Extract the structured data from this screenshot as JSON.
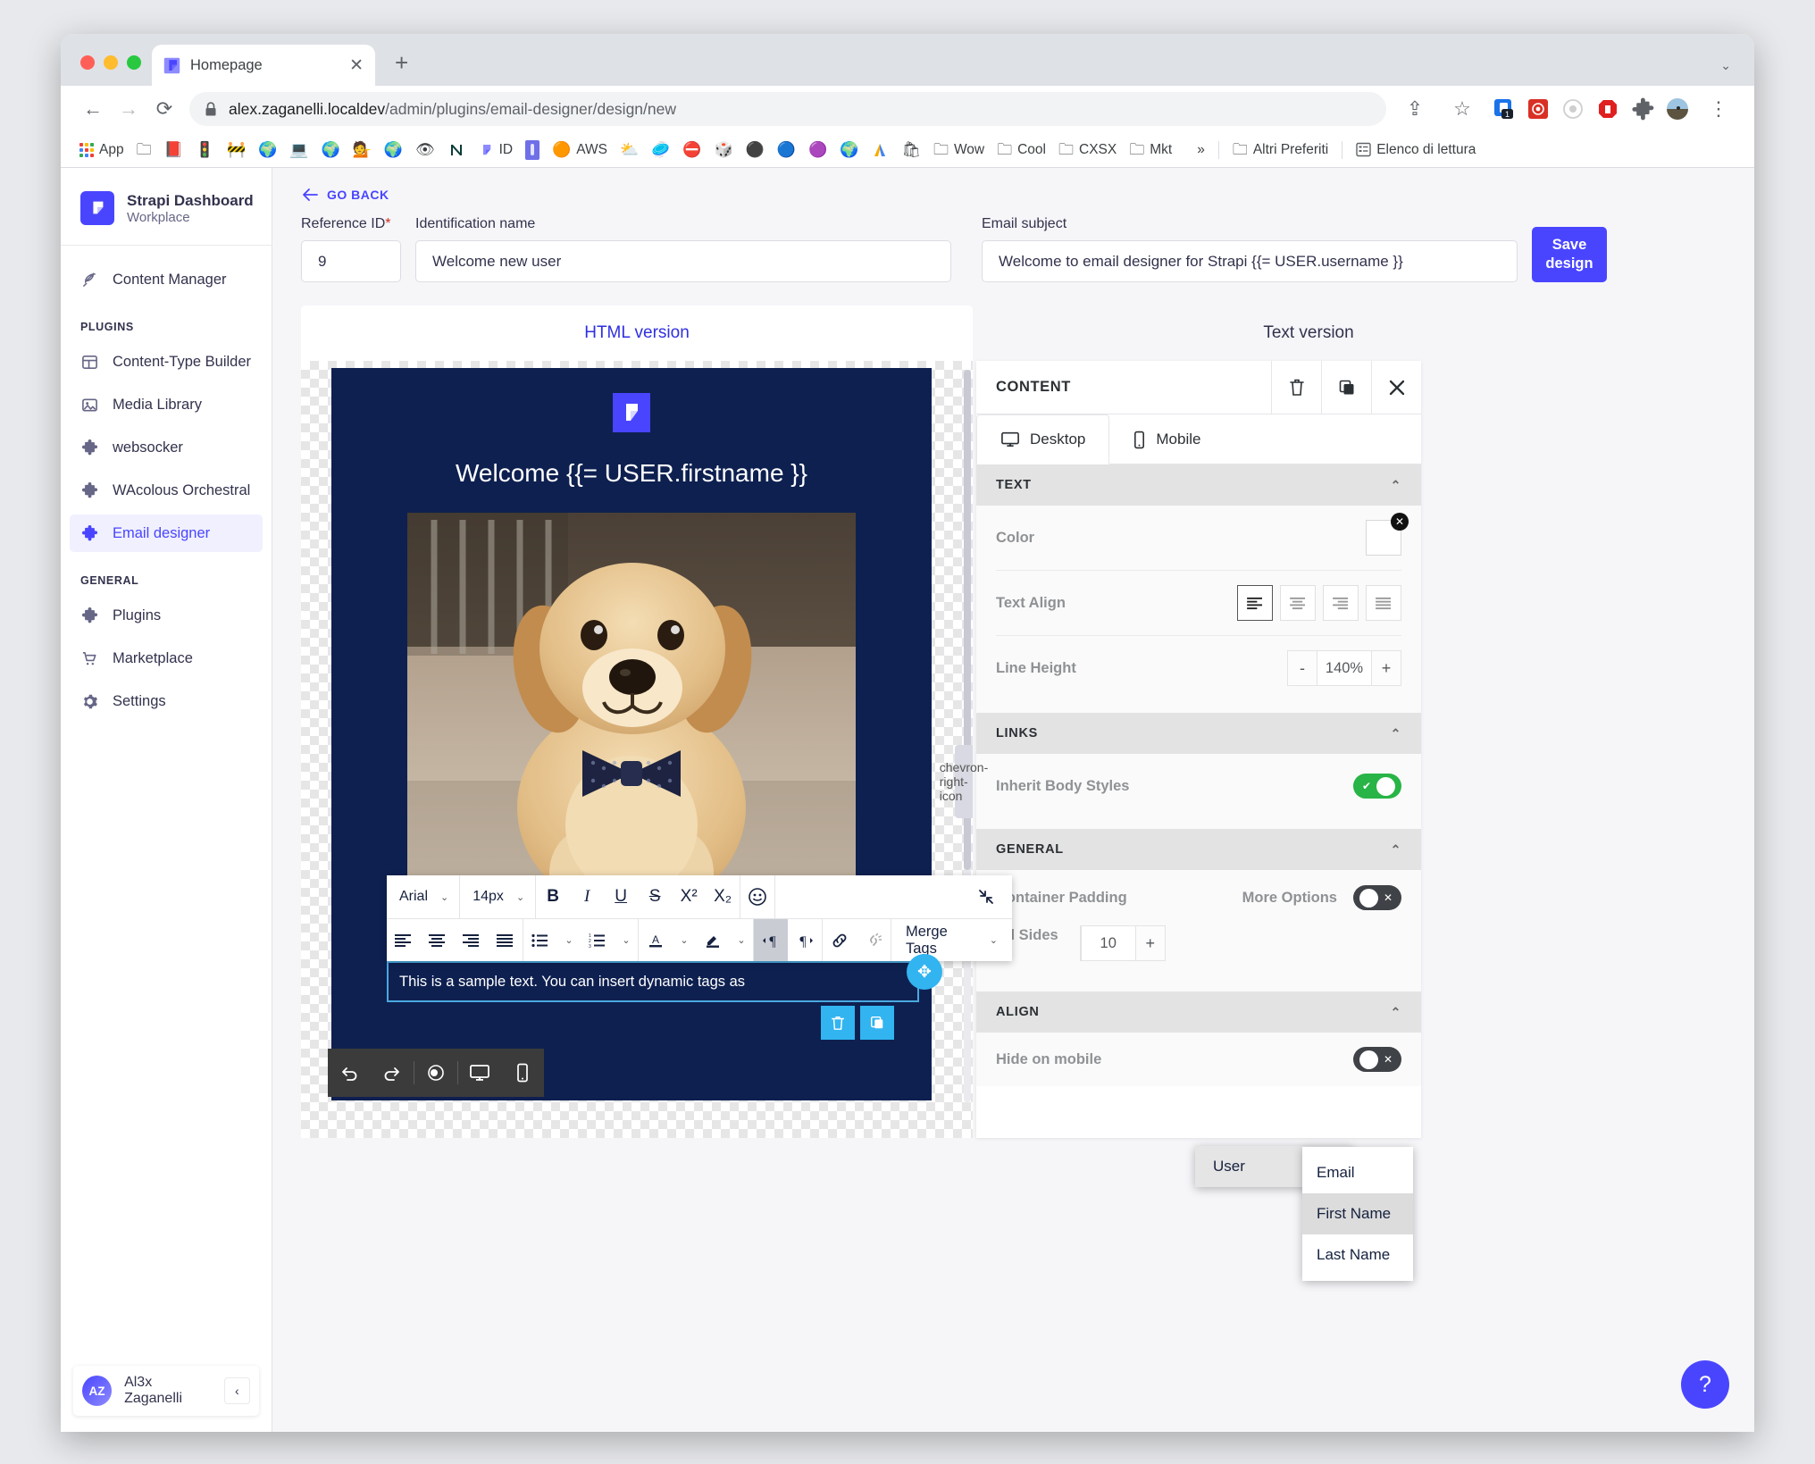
{
  "browser": {
    "tab_title": "Homepage",
    "tab_favicon": "strapi-logo-icon",
    "new_tab": "+",
    "url_host": "alex.zaganelli.localdev",
    "url_path": "/admin/plugins/email-designer/design/new",
    "back_icon": "←",
    "forward_icon": "→",
    "reload_icon": "⟳",
    "lock_icon": "lock-icon",
    "share_icon": "⇪",
    "bookmark_icon": "☆",
    "menu_icon": "⋮",
    "extension_badge": "1",
    "bookmarks": [
      {
        "label": "App",
        "icon": "apps-grid-icon"
      },
      {
        "label": "",
        "icon": "folder-icon"
      },
      {
        "label": "",
        "icon": "red-book-icon"
      },
      {
        "label": "",
        "icon": "traffic-light-icon"
      },
      {
        "label": "",
        "icon": "construction-icon"
      },
      {
        "label": "",
        "icon": "globe-icon"
      },
      {
        "label": "",
        "icon": "computer-icon"
      },
      {
        "label": "",
        "icon": "globe-icon"
      },
      {
        "label": "",
        "icon": "person-icon"
      },
      {
        "label": "",
        "icon": "globe-icon"
      },
      {
        "label": "",
        "icon": "eye-icon"
      },
      {
        "label": "",
        "icon": "notion-icon"
      },
      {
        "label": "ID",
        "icon": "strapi-icon"
      },
      {
        "label": "",
        "icon": "blue-tag-icon"
      },
      {
        "label": "AWS",
        "icon": "aws-cube-icon"
      },
      {
        "label": "",
        "icon": "cloud-icon"
      },
      {
        "label": "",
        "icon": "ellipse-icon"
      },
      {
        "label": "",
        "icon": "red-circle-icon"
      },
      {
        "label": "",
        "icon": "cube-icon"
      },
      {
        "label": "",
        "icon": "black-circle-icon"
      },
      {
        "label": "",
        "icon": "c-circle-icon"
      },
      {
        "label": "",
        "icon": "magenta-circle-icon"
      },
      {
        "label": "",
        "icon": "globe-icon"
      },
      {
        "label": "",
        "icon": "google-ads-icon"
      },
      {
        "label": "",
        "icon": "shopping-bag-icon"
      },
      {
        "label": "Wow",
        "icon": "folder-icon"
      },
      {
        "label": "Cool",
        "icon": "folder-icon"
      },
      {
        "label": "CXSX",
        "icon": "folder-icon"
      },
      {
        "label": "Mkt",
        "icon": "folder-icon"
      }
    ],
    "overflow": "»",
    "other_bookmarks": "Altri Preferiti",
    "reading_list": "Elenco di lettura"
  },
  "sidebar": {
    "brand_name": "Strapi Dashboard",
    "brand_sub": "Workplace",
    "top_items": [
      {
        "label": "Content Manager",
        "icon": "feather-icon"
      }
    ],
    "sections": [
      {
        "label": "PLUGINS",
        "items": [
          {
            "label": "Content-Type Builder",
            "icon": "layout-icon"
          },
          {
            "label": "Media Library",
            "icon": "image-icon"
          },
          {
            "label": "websocker",
            "icon": "puzzle-icon"
          },
          {
            "label": "WAcolous Orchestral",
            "icon": "puzzle-icon"
          },
          {
            "label": "Email designer",
            "icon": "puzzle-icon",
            "active": true
          }
        ]
      },
      {
        "label": "GENERAL",
        "items": [
          {
            "label": "Plugins",
            "icon": "puzzle-icon"
          },
          {
            "label": "Marketplace",
            "icon": "cart-icon"
          },
          {
            "label": "Settings",
            "icon": "gear-icon"
          }
        ]
      }
    ],
    "user": {
      "initials": "AZ",
      "name": "Al3x Zaganelli",
      "collapse_icon": "‹"
    }
  },
  "main": {
    "go_back": "GO BACK",
    "go_back_icon": "arrow-left-icon",
    "fields": {
      "reference_id": {
        "label": "Reference ID",
        "required": "*",
        "value": "9"
      },
      "identification_name": {
        "label": "Identification name",
        "value": "Welcome new user"
      },
      "email_subject": {
        "label": "Email subject",
        "value": "Welcome to email designer for Strapi {{= USER.username }}"
      }
    },
    "save_button": "Save design",
    "version_tabs": [
      {
        "label": "HTML version",
        "active": true
      },
      {
        "label": "Text version",
        "active": false
      }
    ]
  },
  "email": {
    "logo_icon": "strapi-logo-icon",
    "heading": "Welcome {{= USER.firstname }}",
    "image_alt": "golden-retriever-puppy-with-bowtie",
    "text_block": "This is a sample text. You can insert dynamic tags as"
  },
  "editor_toolbar": {
    "font_family": "Arial",
    "font_size": "14px",
    "bold": "B",
    "italic": "I",
    "underline": "U",
    "strike": "S",
    "superscript": "X²",
    "subscript": "X₂",
    "emoji": "☺",
    "collapse_icon": "collapse-arrows-icon",
    "align_left": "align-left-icon",
    "align_center": "align-center-icon",
    "align_right": "align-right-icon",
    "align_justify": "align-justify-icon",
    "bullet_list": "bullet-list-icon",
    "numbered_list": "numbered-list-icon",
    "font_color": "A",
    "highlight": "highlight-pen-icon",
    "ltr": "ltr-icon",
    "rtl": "rtl-icon",
    "link": "link-icon",
    "unlink": "unlink-icon",
    "merge_tags": "Merge Tags",
    "drag_icon": "move-handle-icon",
    "delete_icon": "trash-icon",
    "duplicate_icon": "copy-icon"
  },
  "merge_menu": {
    "group": "User",
    "group_arrow": "›",
    "items": [
      {
        "label": "Email",
        "highlighted": false
      },
      {
        "label": "First Name",
        "highlighted": true
      },
      {
        "label": "Last Name",
        "highlighted": false
      }
    ]
  },
  "preview_bar": {
    "undo_icon": "undo-icon",
    "redo_icon": "redo-icon",
    "preview_icon": "eye-icon",
    "desktop_icon": "desktop-icon",
    "mobile_icon": "mobile-icon"
  },
  "settings": {
    "title": "CONTENT",
    "header_actions": [
      {
        "icon": "trash-icon"
      },
      {
        "icon": "copy-icon"
      },
      {
        "icon": "close-icon"
      }
    ],
    "device_tabs": [
      {
        "label": "Desktop",
        "icon": "desktop-icon",
        "active": true
      },
      {
        "label": "Mobile",
        "icon": "mobile-icon",
        "active": false
      }
    ],
    "sections": [
      {
        "label": "TEXT",
        "rows": [
          {
            "label": "Color",
            "control": "color-swatch",
            "value": "#ffffff"
          },
          {
            "label": "Text Align",
            "control": "align-group",
            "selected": 0
          },
          {
            "label": "Line Height",
            "control": "stepper",
            "value": "140%",
            "minus": "-",
            "plus": "+"
          }
        ]
      },
      {
        "label": "LINKS",
        "rows": [
          {
            "label": "Inherit Body Styles",
            "control": "toggle",
            "value": "on"
          }
        ]
      },
      {
        "label": "GENERAL",
        "rows": [
          {
            "label": "Container Padding",
            "label2": "More Options",
            "control": "toggle",
            "value": "off"
          },
          {
            "label": "All Sides",
            "control": "stepper",
            "value": "10",
            "plus": "+"
          }
        ]
      },
      {
        "label": "ALIGN",
        "rows": [
          {
            "label": "Hide on mobile",
            "control": "toggle",
            "value": "off"
          }
        ]
      }
    ],
    "drawer_handle_icon": "chevron-right-icon"
  },
  "help": {
    "icon": "?"
  },
  "colors": {
    "accent": "#4945ff",
    "email_bg": "#0e2050",
    "selection": "#4aa8e0",
    "toggle_on": "#28b446",
    "required": "#d02b20"
  }
}
